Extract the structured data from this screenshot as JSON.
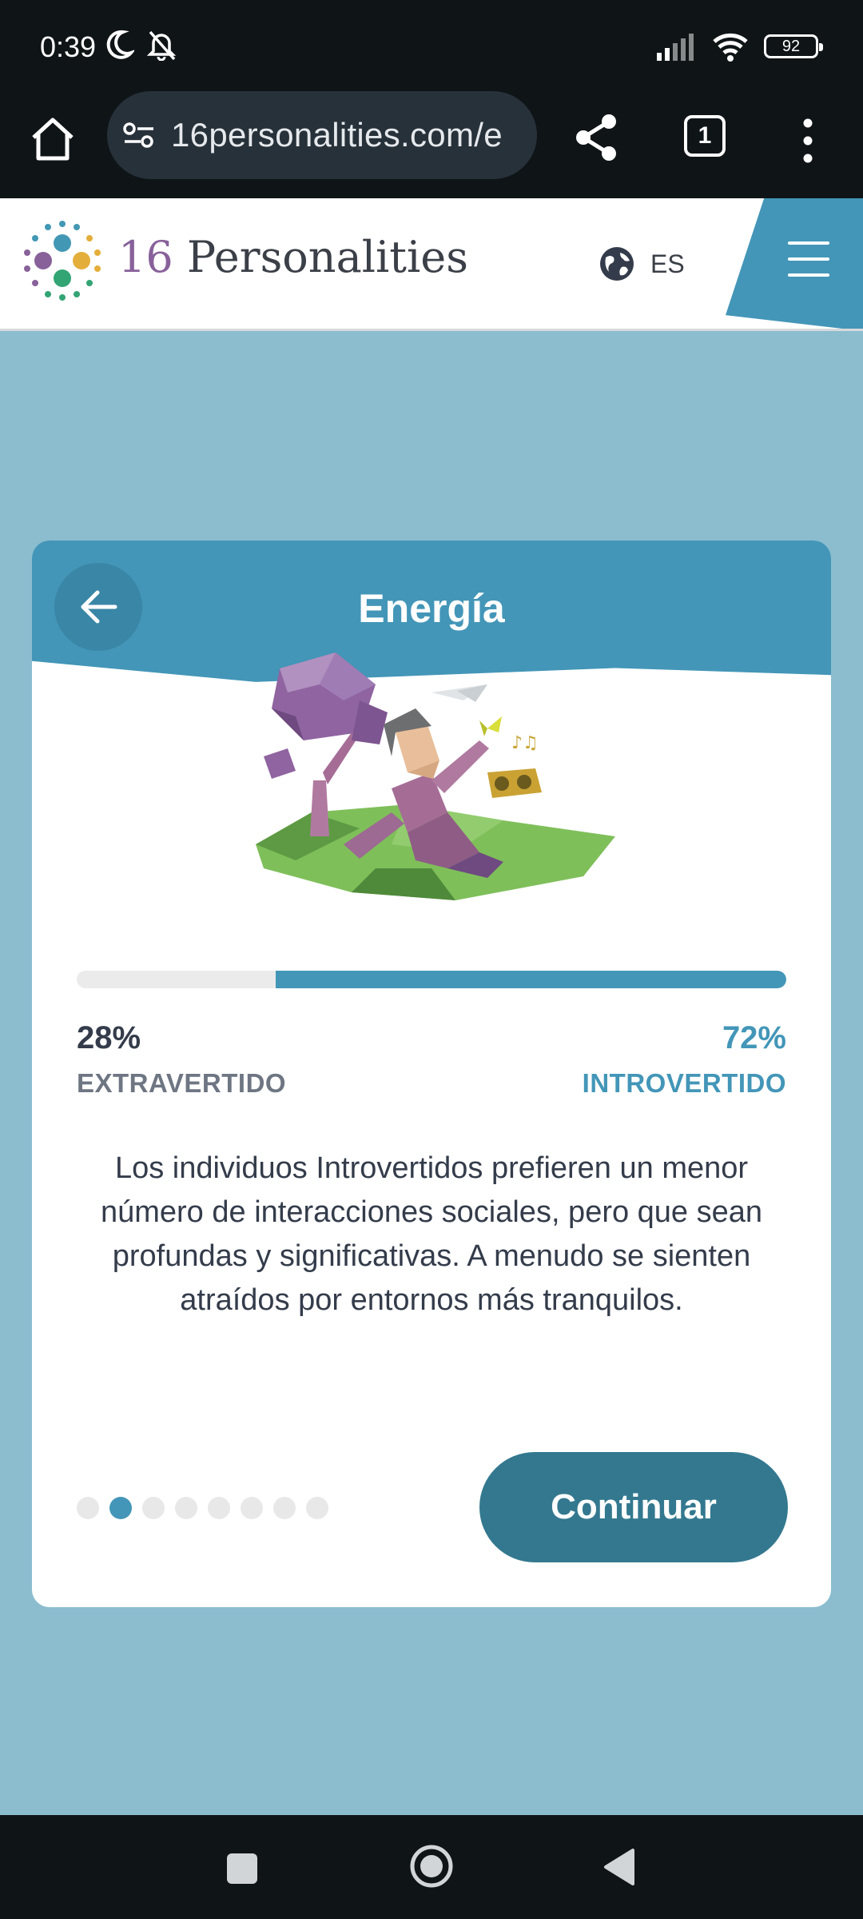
{
  "status_bar": {
    "time": "0:39",
    "battery": "92",
    "icons": [
      "moon-icon",
      "bell-off-icon",
      "signal-icon",
      "wifi-icon",
      "battery-icon"
    ]
  },
  "browser": {
    "url": "16personalities.com/e",
    "tab_count": "1"
  },
  "site": {
    "logo_number": "16",
    "logo_name": "Personalities",
    "language_code": "ES"
  },
  "card": {
    "title": "Energía",
    "progress_fraction": 0.72,
    "left_percent": "28%",
    "left_label": "EXTRAVERTIDO",
    "right_percent": "72%",
    "right_label": "INTROVERTIDO",
    "description": "Los individuos Introvertidos prefieren un menor número de interacciones sociales, pero que sean profundas y significativas. A menudo se sienten atraídos por entornos más tranquilos.",
    "step_current": 2,
    "step_total": 8,
    "continue_label": "Continuar"
  },
  "colors": {
    "accent": "#4396b8",
    "button": "#33788f",
    "page_bg": "#8bbdcf",
    "text_dark": "#343c4b"
  }
}
